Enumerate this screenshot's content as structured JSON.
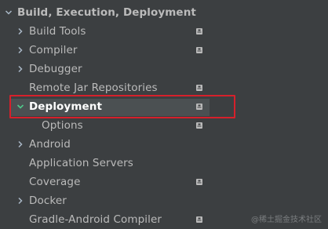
{
  "tree": {
    "header": {
      "label": "Build, Execution, Deployment"
    },
    "items": [
      {
        "label": "Build Tools"
      },
      {
        "label": "Compiler"
      },
      {
        "label": "Debugger"
      },
      {
        "label": "Remote Jar Repositories"
      },
      {
        "label": "Deployment"
      },
      {
        "label": "Options"
      },
      {
        "label": "Android"
      },
      {
        "label": "Application Servers"
      },
      {
        "label": "Coverage"
      },
      {
        "label": "Docker"
      },
      {
        "label": "Gradle-Android Compiler"
      }
    ]
  },
  "colors": {
    "background": "#3c3f41",
    "text": "#bbbbbb",
    "selected_text": "#ffffff",
    "selection_fill": "#4b5052",
    "highlight_border": "#d6202b",
    "expanded_arrow": "#4ec98a"
  },
  "icons": {
    "collapsed": "chevron-right-icon",
    "expanded": "chevron-down-icon",
    "project_level": "project-settings-icon"
  },
  "watermark": "@稀土掘金技术社区"
}
